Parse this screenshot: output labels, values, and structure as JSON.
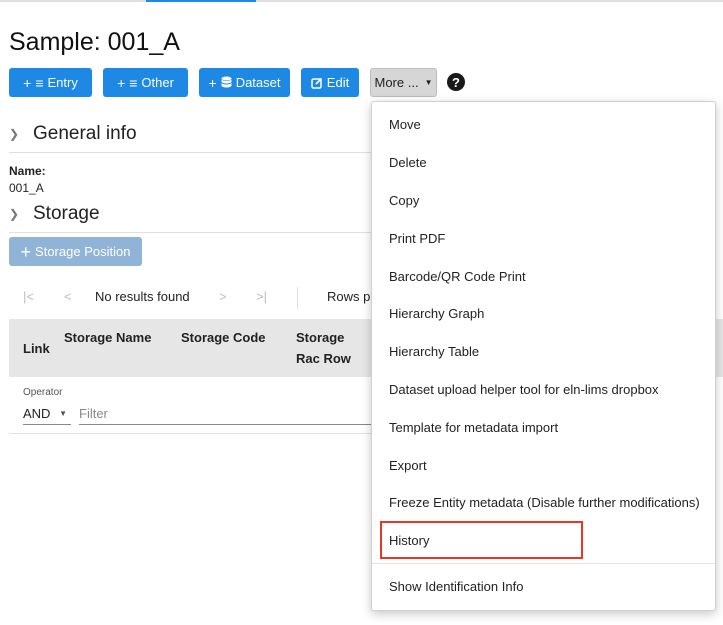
{
  "page": {
    "title": "Sample: 001_A"
  },
  "toolbar": {
    "entry_label": "Entry",
    "other_label": "Other",
    "dataset_label": "Dataset",
    "edit_label": "Edit",
    "more_label": "More ...",
    "help_icon": "?"
  },
  "sections": {
    "general": "General info",
    "storage": "Storage"
  },
  "fields": {
    "name_label": "Name:",
    "name_value": "001_A"
  },
  "storage": {
    "add_label": "Storage Position",
    "pager_status": "No results found",
    "rows_label": "Rows pe",
    "columns": [
      "Link",
      "Storage Name",
      "Storage Code",
      "Storage Rac Row"
    ],
    "operator_label": "Operator",
    "operator_value": "AND",
    "filter_placeholder": "Filter"
  },
  "menu": {
    "items": [
      "Move",
      "Delete",
      "Copy",
      "Print PDF",
      "Barcode/QR Code Print",
      "Hierarchy Graph",
      "Hierarchy Table",
      "Dataset upload helper tool for eln-lims dropbox",
      "Template for metadata import",
      "Export",
      "Freeze Entity metadata (Disable further modifications)",
      "History",
      "Show Identification Info"
    ]
  },
  "colors": {
    "primary": "#1e88e5",
    "highlight": "#e53923",
    "disabled": "#90b4d8"
  }
}
